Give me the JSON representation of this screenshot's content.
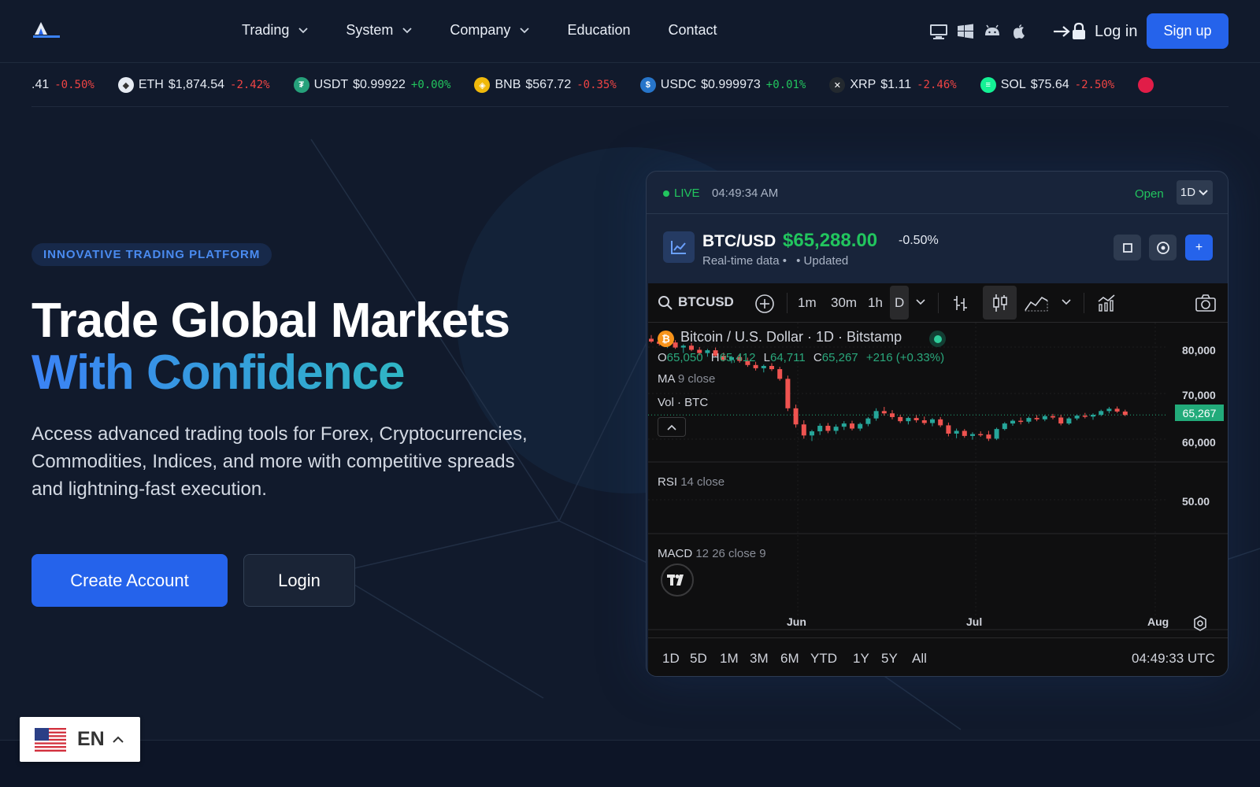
{
  "nav": {
    "links": [
      {
        "label": "Trading",
        "has_menu": true
      },
      {
        "label": "System",
        "has_menu": true
      },
      {
        "label": "Company",
        "has_menu": true
      },
      {
        "label": "Education",
        "has_menu": false
      },
      {
        "label": "Contact",
        "has_menu": false
      }
    ],
    "platform_icons": [
      "desktop-icon",
      "windows-icon",
      "android-icon",
      "apple-icon"
    ],
    "login_label": "Log in",
    "signup_label": "Sign up"
  },
  "ticker": [
    {
      "symbol": "",
      "price": ".41",
      "change": "-0.50%",
      "dir": "neg",
      "icon": "",
      "color": ""
    },
    {
      "symbol": "ETH",
      "price": "$1,874.54",
      "change": "-2.42%",
      "dir": "neg",
      "icon": "eth-icon",
      "color": "#e6ebf3"
    },
    {
      "symbol": "USDT",
      "price": "$0.99922",
      "change": "+0.00%",
      "dir": "pos",
      "icon": "usdt-icon",
      "color": "#26a17b"
    },
    {
      "symbol": "BNB",
      "price": "$567.72",
      "change": "-0.35%",
      "dir": "neg",
      "icon": "bnb-icon",
      "color": "#f0b90b"
    },
    {
      "symbol": "USDC",
      "price": "$0.999973",
      "change": "+0.01%",
      "dir": "pos",
      "icon": "usdc-icon",
      "color": "#2775ca"
    },
    {
      "symbol": "XRP",
      "price": "$1.11",
      "change": "-2.46%",
      "dir": "neg",
      "icon": "xrp-icon",
      "color": "#23292f"
    },
    {
      "symbol": "SOL",
      "price": "$75.64",
      "change": "-2.50%",
      "dir": "neg",
      "icon": "sol-icon",
      "color": "#14f195"
    }
  ],
  "hero": {
    "badge": "INNOVATIVE TRADING PLATFORM",
    "title_line1": "Trade Global Markets",
    "title_line2": "With Confidence",
    "description": "Access advanced trading tools for Forex, Cryptocurrencies, Commodities, Indices, and more with competitive spreads and lightning-fast execution.",
    "primary_cta": "Create Account",
    "secondary_cta": "Login"
  },
  "widget": {
    "live_label": "LIVE",
    "time": "04:49:34 AM",
    "market_status": "Open",
    "interval": "1D",
    "pair": "BTC/USD",
    "price": "$65,288.00",
    "change_pct": "-0.50%",
    "sub_label": "Real-time data •",
    "updated_label": "• Updated",
    "add_label": "+"
  },
  "chart": {
    "symbol": "BTCUSD",
    "intervals": [
      "1m",
      "30m",
      "1h",
      "D"
    ],
    "title": "Bitcoin / U.S. Dollar · 1D · Bitstamp",
    "ohlc": {
      "o_label": "O",
      "o": "65,050",
      "h_label": "H",
      "h": "65,412",
      "l_label": "L",
      "l": "64,711",
      "c_label": "C",
      "c": "65,267",
      "chg": "+216 (+0.33%)"
    },
    "ma_label": "MA",
    "ma_params": "9 close",
    "vol_label": "Vol · BTC",
    "rsi_label": "RSI",
    "rsi_params": "14 close",
    "macd_label": "MACD",
    "macd_params": "12 26 close 9",
    "price_axis": [
      "80,000",
      "70,000",
      "60,000"
    ],
    "last_price_tag": "65,267",
    "rsi_axis": "50.00",
    "time_axis": [
      "Jun",
      "Jul",
      "Aug"
    ],
    "ranges": [
      "1D",
      "5D",
      "1M",
      "3M",
      "6M",
      "YTD",
      "1Y",
      "5Y",
      "All"
    ],
    "utc_time": "04:49:33 UTC",
    "candles": [
      [
        81800,
        82600,
        80900,
        81200
      ],
      [
        81200,
        81800,
        80300,
        80700
      ],
      [
        80700,
        81400,
        79800,
        81000
      ],
      [
        81000,
        81500,
        79600,
        79900
      ],
      [
        79900,
        80600,
        78700,
        80300
      ],
      [
        80300,
        80900,
        79100,
        79400
      ],
      [
        79400,
        80000,
        78200,
        78700
      ],
      [
        78700,
        79600,
        77900,
        79300
      ],
      [
        79300,
        79900,
        77800,
        78100
      ],
      [
        78100,
        78800,
        76900,
        77200
      ],
      [
        77200,
        78100,
        76500,
        77800
      ],
      [
        77800,
        78300,
        76600,
        77000
      ],
      [
        77000,
        77700,
        75700,
        76100
      ],
      [
        76100,
        76800,
        74900,
        75400
      ],
      [
        75400,
        76200,
        74500,
        75900
      ],
      [
        75900,
        76500,
        74800,
        75200
      ],
      [
        75200,
        75700,
        72700,
        73100
      ],
      [
        73100,
        73800,
        66100,
        66700
      ],
      [
        66700,
        67500,
        62500,
        63200
      ],
      [
        63200,
        64100,
        60100,
        60800
      ],
      [
        60800,
        62000,
        59600,
        61700
      ],
      [
        61700,
        63400,
        60900,
        62900
      ],
      [
        62900,
        63500,
        61300,
        61800
      ],
      [
        61800,
        63200,
        61100,
        62700
      ],
      [
        62700,
        63900,
        62000,
        63400
      ],
      [
        63400,
        64000,
        61900,
        62300
      ],
      [
        62300,
        63600,
        61800,
        63300
      ],
      [
        63300,
        64800,
        62800,
        64500
      ],
      [
        64500,
        66700,
        64000,
        66100
      ],
      [
        66100,
        67000,
        65100,
        65600
      ],
      [
        65600,
        66300,
        64300,
        64800
      ],
      [
        64800,
        65300,
        63500,
        63900
      ],
      [
        63900,
        64900,
        63200,
        64600
      ],
      [
        64600,
        65200,
        63600,
        64100
      ],
      [
        64100,
        64900,
        63100,
        63500
      ],
      [
        63500,
        64600,
        62800,
        64300
      ],
      [
        64300,
        64800,
        62600,
        63000
      ],
      [
        63000,
        63600,
        60600,
        61200
      ],
      [
        61200,
        62300,
        60200,
        61800
      ],
      [
        61800,
        62200,
        60300,
        60700
      ],
      [
        60700,
        61500,
        59900,
        61100
      ],
      [
        61100,
        61700,
        60500,
        61000
      ],
      [
        61000,
        61800,
        59600,
        60100
      ],
      [
        60100,
        62500,
        59800,
        62200
      ],
      [
        62200,
        63700,
        61900,
        63400
      ],
      [
        63400,
        64300,
        62900,
        64000
      ],
      [
        64000,
        64700,
        63200,
        63800
      ],
      [
        63800,
        64900,
        63400,
        64600
      ],
      [
        64600,
        65200,
        63900,
        64300
      ],
      [
        64300,
        65300,
        63900,
        65000
      ],
      [
        65000,
        65500,
        64300,
        64700
      ],
      [
        64700,
        65300,
        63000,
        63400
      ],
      [
        63400,
        64800,
        63100,
        64500
      ],
      [
        64500,
        65400,
        64100,
        65100
      ],
      [
        65100,
        65700,
        64500,
        64900
      ],
      [
        64900,
        65600,
        64200,
        65300
      ],
      [
        65300,
        66400,
        65000,
        66100
      ],
      [
        66100,
        67000,
        65600,
        66600
      ],
      [
        66600,
        67100,
        65700,
        66000
      ],
      [
        66000,
        66400,
        65000,
        65267
      ]
    ]
  }
}
